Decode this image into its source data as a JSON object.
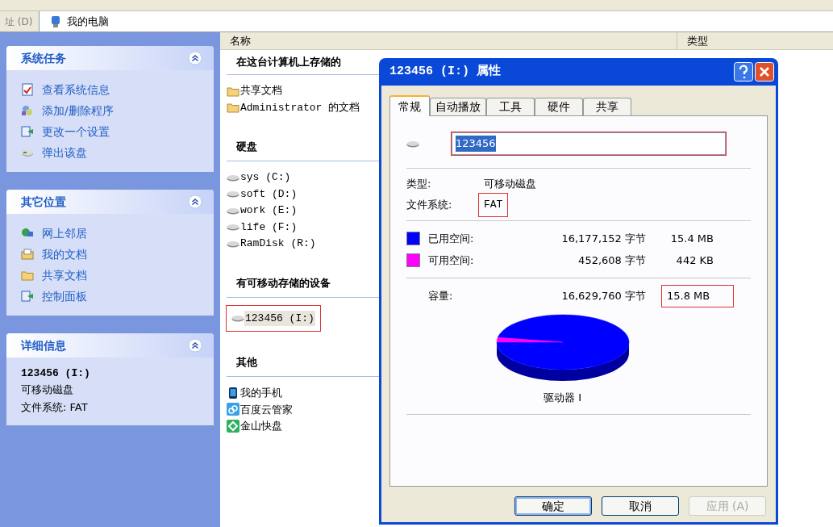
{
  "address_bar": {
    "label": "址 (D)",
    "value": "我的电脑"
  },
  "task_panes": [
    {
      "title": "系统任务",
      "expanded": true,
      "items": [
        {
          "label": "查看系统信息",
          "kind": "info"
        },
        {
          "label": "添加/删除程序",
          "kind": "programs"
        },
        {
          "label": "更改一个设置",
          "kind": "settings"
        },
        {
          "label": "弹出该盘",
          "kind": "eject"
        }
      ]
    },
    {
      "title": "其它位置",
      "expanded": true,
      "items": [
        {
          "label": "网上邻居",
          "kind": "network"
        },
        {
          "label": "我的文档",
          "kind": "documents"
        },
        {
          "label": "共享文档",
          "kind": "folder"
        },
        {
          "label": "控制面板",
          "kind": "settings"
        }
      ]
    },
    {
      "title": "详细信息",
      "expanded": true,
      "details": [
        {
          "text": "123456 (I:)",
          "kind": "title"
        },
        {
          "text": "可移动磁盘",
          "kind": "text"
        },
        {
          "text": "文件系统: FAT",
          "kind": "text"
        }
      ]
    }
  ],
  "file_list": {
    "columns": [
      "名称",
      "类型"
    ],
    "groups": [
      {
        "title": "在这台计算机上存储的",
        "items": [
          {
            "label": "共享文档",
            "kind": "folder",
            "selected": false,
            "highlighted": false
          },
          {
            "label": "Administrator 的文档",
            "kind": "folder",
            "selected": false,
            "highlighted": false
          }
        ]
      },
      {
        "title": "硬盘",
        "items": [
          {
            "label": "sys (C:)",
            "kind": "drive",
            "selected": false,
            "highlighted": false
          },
          {
            "label": "soft (D:)",
            "kind": "drive",
            "selected": false,
            "highlighted": false
          },
          {
            "label": "work (E:)",
            "kind": "drive",
            "selected": false,
            "highlighted": false
          },
          {
            "label": "life (F:)",
            "kind": "drive",
            "selected": false,
            "highlighted": false
          },
          {
            "label": "RamDisk (R:)",
            "kind": "drive",
            "selected": false,
            "highlighted": false
          }
        ]
      },
      {
        "title": "有可移动存储的设备",
        "items": [
          {
            "label": "123456 (I:)",
            "kind": "drive",
            "selected": true,
            "highlighted": true
          }
        ]
      },
      {
        "title": "其他",
        "items": [
          {
            "label": "我的手机",
            "kind": "phone",
            "selected": false,
            "highlighted": false
          },
          {
            "label": "百度云管家",
            "kind": "cloud",
            "selected": false,
            "highlighted": false
          },
          {
            "label": "金山快盘",
            "kind": "diamond",
            "selected": false,
            "highlighted": false
          }
        ]
      }
    ]
  },
  "dialog": {
    "title": "123456 (I:) 属性",
    "tabs": [
      {
        "label": "常规",
        "selected": true
      },
      {
        "label": "自动播放",
        "selected": false
      },
      {
        "label": "工具",
        "selected": false
      },
      {
        "label": "硬件",
        "selected": false
      },
      {
        "label": "共享",
        "selected": false
      }
    ],
    "name_field": {
      "value": "123456",
      "text_selected": true,
      "highlighted": true
    },
    "type": {
      "label": "类型:",
      "value": "可移动磁盘",
      "highlighted": false
    },
    "file_system": {
      "label": "文件系统:",
      "value": "FAT",
      "highlighted": true
    },
    "space": [
      {
        "label": "已用空间:",
        "bytes": "16,177,152 字节",
        "size": "15.4 MB",
        "color": "#0000ff"
      },
      {
        "label": "可用空间:",
        "bytes": "452,608 字节",
        "size": "442 KB",
        "color": "#ff00ff"
      }
    ],
    "capacity": {
      "label": "容量:",
      "bytes": "16,629,760 字节",
      "size": "15.8 MB",
      "highlighted": true
    },
    "chart_title": "驱动器 I",
    "buttons": [
      {
        "label": "确定",
        "default": true,
        "disabled": false
      },
      {
        "label": "取消",
        "default": false,
        "disabled": false
      },
      {
        "label": "应用 (A)",
        "default": false,
        "disabled": true
      }
    ]
  }
}
